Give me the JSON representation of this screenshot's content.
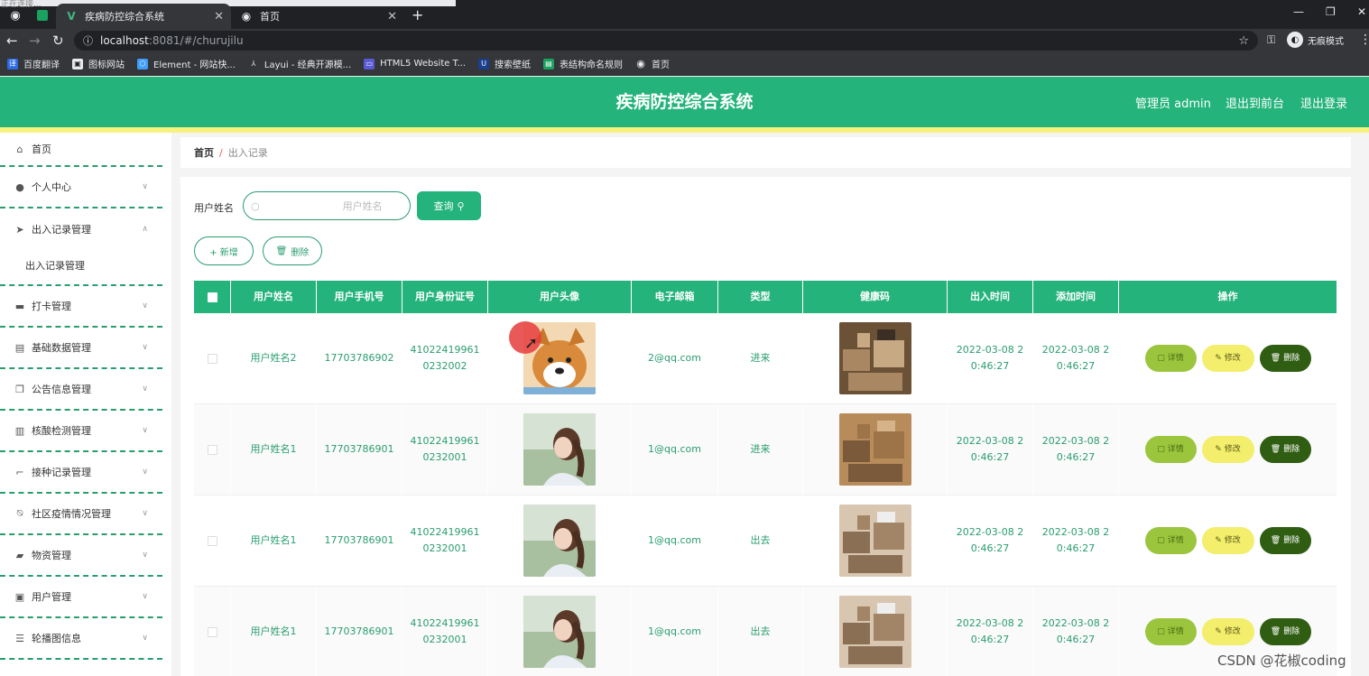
{
  "browser": {
    "loading_text": "正在连接...",
    "tabs": [
      {
        "title": "疾病防控综合系统",
        "icon": "vue-icon"
      },
      {
        "title": "首页",
        "icon": "globe-icon"
      }
    ],
    "url_host": "localhost",
    "url_path": ":8081/#/churujilu",
    "incognito_label": "无痕模式",
    "bookmarks": [
      {
        "label": "百度翻译",
        "color": "#2d6be4"
      },
      {
        "label": "图标网站",
        "color": "#222222"
      },
      {
        "label": "Element - 网站快...",
        "color": "#409eff"
      },
      {
        "label": "Layui - 经典开源模...",
        "color": "#333333"
      },
      {
        "label": "HTML5 Website T...",
        "color": "#5a5ad6"
      },
      {
        "label": "搜索壁纸",
        "color": "#1a3f8f"
      },
      {
        "label": "表结构命名规则",
        "color": "#1aa260"
      },
      {
        "label": "首页",
        "color": "#777777"
      }
    ]
  },
  "header": {
    "title": "疾病防控综合系统",
    "admin": "管理员 admin",
    "back_front": "退出到前台",
    "logout": "退出登录"
  },
  "sidebar": {
    "items": [
      {
        "label": "首页",
        "icon": "home-icon"
      },
      {
        "label": "个人中心",
        "icon": "user-icon"
      },
      {
        "label": "出入记录管理",
        "icon": "send-icon"
      },
      {
        "label": "出入记录管理",
        "icon": ""
      },
      {
        "label": "打卡管理",
        "icon": "briefcase-icon"
      },
      {
        "label": "基础数据管理",
        "icon": "clipboard-icon"
      },
      {
        "label": "公告信息管理",
        "icon": "copy-icon"
      },
      {
        "label": "核酸检测管理",
        "icon": "bar-chart-icon"
      },
      {
        "label": "接种记录管理",
        "icon": "crop-icon"
      },
      {
        "label": "社区疫情情况管理",
        "icon": "mute-icon"
      },
      {
        "label": "物资管理",
        "icon": "box-icon"
      },
      {
        "label": "用户管理",
        "icon": "user-card-icon"
      },
      {
        "label": "轮播图信息",
        "icon": "sliders-icon"
      }
    ]
  },
  "breadcrumb": {
    "home": "首页",
    "sep": "/",
    "current": "出入记录"
  },
  "search": {
    "label": "用户姓名",
    "placeholder": "用户姓名",
    "query_button": "查询"
  },
  "toolbar": {
    "add": "+ 新增",
    "delete": "删除"
  },
  "table": {
    "headers": [
      "用户姓名",
      "用户手机号",
      "用户身份证号",
      "用户头像",
      "电子邮箱",
      "类型",
      "健康码",
      "出入时间",
      "添加时间",
      "操作"
    ],
    "rows": [
      {
        "name": "用户姓名2",
        "phone": "17703786902",
        "id1": "41022419961",
        "id2": "0232002",
        "email": "2@qq.com",
        "type": "进来",
        "t1": "2022-03-08 2",
        "t2": "0:46:27",
        "a1": "2022-03-08 2",
        "a2": "0:46:27",
        "avatar": "dog"
      },
      {
        "name": "用户姓名1",
        "phone": "17703786901",
        "id1": "41022419961",
        "id2": "0232001",
        "email": "1@qq.com",
        "type": "进来",
        "t1": "2022-03-08 2",
        "t2": "0:46:27",
        "a1": "2022-03-08 2",
        "a2": "0:46:27",
        "avatar": "girl"
      },
      {
        "name": "用户姓名1",
        "phone": "17703786901",
        "id1": "41022419961",
        "id2": "0232001",
        "email": "1@qq.com",
        "type": "出去",
        "t1": "2022-03-08 2",
        "t2": "0:46:27",
        "a1": "2022-03-08 2",
        "a2": "0:46:27",
        "avatar": "girl"
      },
      {
        "name": "用户姓名1",
        "phone": "17703786901",
        "id1": "41022419961",
        "id2": "0232001",
        "email": "1@qq.com",
        "type": "出去",
        "t1": "2022-03-08 2",
        "t2": "0:46:27",
        "a1": "2022-03-08 2",
        "a2": "0:46:27",
        "avatar": "girl"
      }
    ],
    "actions": {
      "detail": "详情",
      "edit": "修改",
      "delete": "删除"
    }
  },
  "watermark": "CSDN @花椒coding",
  "colors": {
    "primary": "#24b37b",
    "accent_yellow": "#f7f27d",
    "text_green": "#2a9d6f"
  }
}
